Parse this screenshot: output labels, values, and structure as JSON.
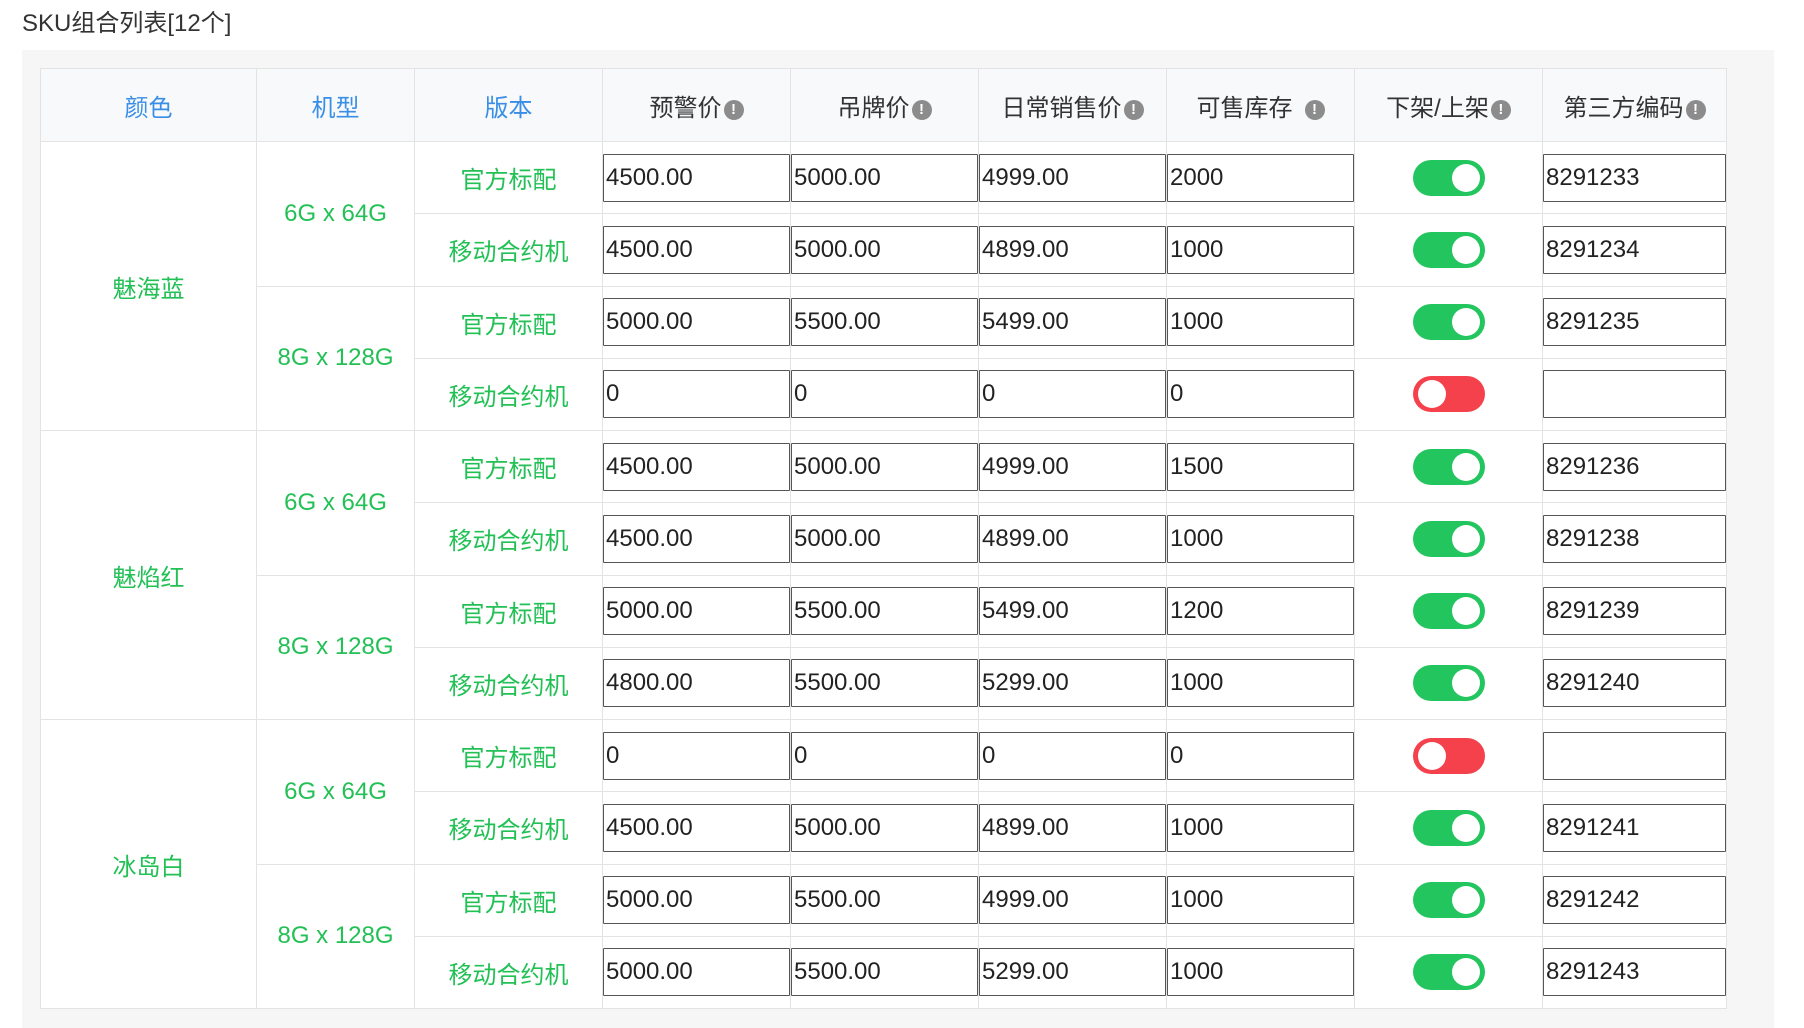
{
  "title": "SKU组合列表[12个]",
  "colors": {
    "header_blue": "#3a8ee6",
    "label_green": "#22c055",
    "toggle_on": "#22c55e",
    "toggle_off": "#f4414c"
  },
  "headers": {
    "color": "颜色",
    "model": "机型",
    "version": "版本",
    "warning_price": "预警价",
    "tag_price": "吊牌价",
    "daily_price": "日常销售价",
    "stock": "可售库存",
    "shelf": "下架/上架",
    "third_code": "第三方编码",
    "hint_icon": "!"
  },
  "groups": [
    {
      "color": "魅海蓝",
      "models": [
        {
          "model": "6G x 64G",
          "rows": [
            {
              "version": "官方标配",
              "warning": "4500.00",
              "tag": "5000.00",
              "daily": "4999.00",
              "stock": "2000",
              "on": true,
              "code": "8291233"
            },
            {
              "version": "移动合约机",
              "warning": "4500.00",
              "tag": "5000.00",
              "daily": "4899.00",
              "stock": "1000",
              "on": true,
              "code": "8291234"
            }
          ]
        },
        {
          "model": "8G x 128G",
          "rows": [
            {
              "version": "官方标配",
              "warning": "5000.00",
              "tag": "5500.00",
              "daily": "5499.00",
              "stock": "1000",
              "on": true,
              "code": "8291235"
            },
            {
              "version": "移动合约机",
              "warning": "0",
              "tag": "0",
              "daily": "0",
              "stock": "0",
              "on": false,
              "code": ""
            }
          ]
        }
      ]
    },
    {
      "color": "魅焰红",
      "models": [
        {
          "model": "6G x 64G",
          "rows": [
            {
              "version": "官方标配",
              "warning": "4500.00",
              "tag": "5000.00",
              "daily": "4999.00",
              "stock": "1500",
              "on": true,
              "code": "8291236"
            },
            {
              "version": "移动合约机",
              "warning": "4500.00",
              "tag": "5000.00",
              "daily": "4899.00",
              "stock": "1000",
              "on": true,
              "code": "8291238"
            }
          ]
        },
        {
          "model": "8G x 128G",
          "rows": [
            {
              "version": "官方标配",
              "warning": "5000.00",
              "tag": "5500.00",
              "daily": "5499.00",
              "stock": "1200",
              "on": true,
              "code": "8291239"
            },
            {
              "version": "移动合约机",
              "warning": "4800.00",
              "tag": "5500.00",
              "daily": "5299.00",
              "stock": "1000",
              "on": true,
              "code": "8291240"
            }
          ]
        }
      ]
    },
    {
      "color": "冰岛白",
      "models": [
        {
          "model": "6G x 64G",
          "rows": [
            {
              "version": "官方标配",
              "warning": "0",
              "tag": "0",
              "daily": "0",
              "stock": "0",
              "on": false,
              "code": ""
            },
            {
              "version": "移动合约机",
              "warning": "4500.00",
              "tag": "5000.00",
              "daily": "4899.00",
              "stock": "1000",
              "on": true,
              "code": "8291241"
            }
          ]
        },
        {
          "model": "8G x 128G",
          "rows": [
            {
              "version": "官方标配",
              "warning": "5000.00",
              "tag": "5500.00",
              "daily": "4999.00",
              "stock": "1000",
              "on": true,
              "code": "8291242"
            },
            {
              "version": "移动合约机",
              "warning": "5000.00",
              "tag": "5500.00",
              "daily": "5299.00",
              "stock": "1000",
              "on": true,
              "code": "8291243"
            }
          ]
        }
      ]
    }
  ]
}
